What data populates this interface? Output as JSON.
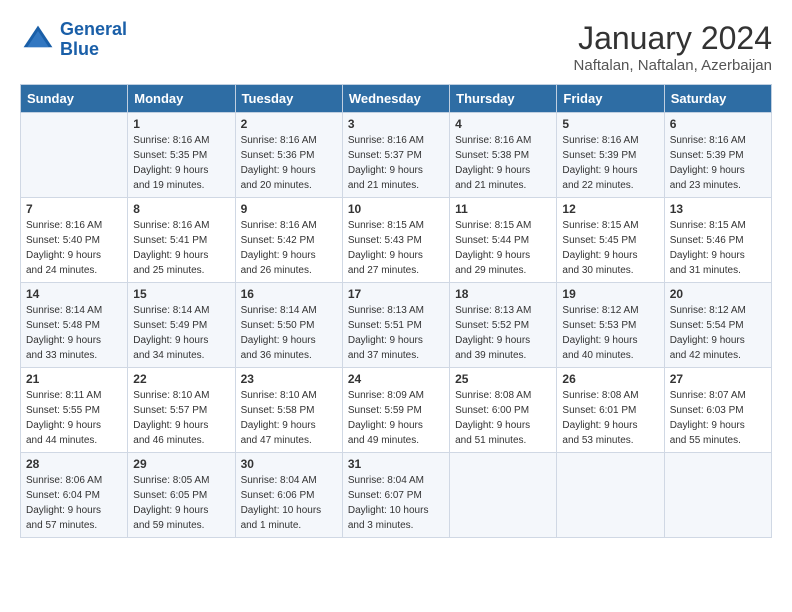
{
  "header": {
    "logo_line1": "General",
    "logo_line2": "Blue",
    "month_title": "January 2024",
    "location": "Naftalan, Naftalan, Azerbaijan"
  },
  "days_of_week": [
    "Sunday",
    "Monday",
    "Tuesday",
    "Wednesday",
    "Thursday",
    "Friday",
    "Saturday"
  ],
  "weeks": [
    [
      {
        "day": "",
        "info": ""
      },
      {
        "day": "1",
        "info": "Sunrise: 8:16 AM\nSunset: 5:35 PM\nDaylight: 9 hours\nand 19 minutes."
      },
      {
        "day": "2",
        "info": "Sunrise: 8:16 AM\nSunset: 5:36 PM\nDaylight: 9 hours\nand 20 minutes."
      },
      {
        "day": "3",
        "info": "Sunrise: 8:16 AM\nSunset: 5:37 PM\nDaylight: 9 hours\nand 21 minutes."
      },
      {
        "day": "4",
        "info": "Sunrise: 8:16 AM\nSunset: 5:38 PM\nDaylight: 9 hours\nand 21 minutes."
      },
      {
        "day": "5",
        "info": "Sunrise: 8:16 AM\nSunset: 5:39 PM\nDaylight: 9 hours\nand 22 minutes."
      },
      {
        "day": "6",
        "info": "Sunrise: 8:16 AM\nSunset: 5:39 PM\nDaylight: 9 hours\nand 23 minutes."
      }
    ],
    [
      {
        "day": "7",
        "info": "Sunrise: 8:16 AM\nSunset: 5:40 PM\nDaylight: 9 hours\nand 24 minutes."
      },
      {
        "day": "8",
        "info": "Sunrise: 8:16 AM\nSunset: 5:41 PM\nDaylight: 9 hours\nand 25 minutes."
      },
      {
        "day": "9",
        "info": "Sunrise: 8:16 AM\nSunset: 5:42 PM\nDaylight: 9 hours\nand 26 minutes."
      },
      {
        "day": "10",
        "info": "Sunrise: 8:15 AM\nSunset: 5:43 PM\nDaylight: 9 hours\nand 27 minutes."
      },
      {
        "day": "11",
        "info": "Sunrise: 8:15 AM\nSunset: 5:44 PM\nDaylight: 9 hours\nand 29 minutes."
      },
      {
        "day": "12",
        "info": "Sunrise: 8:15 AM\nSunset: 5:45 PM\nDaylight: 9 hours\nand 30 minutes."
      },
      {
        "day": "13",
        "info": "Sunrise: 8:15 AM\nSunset: 5:46 PM\nDaylight: 9 hours\nand 31 minutes."
      }
    ],
    [
      {
        "day": "14",
        "info": "Sunrise: 8:14 AM\nSunset: 5:48 PM\nDaylight: 9 hours\nand 33 minutes."
      },
      {
        "day": "15",
        "info": "Sunrise: 8:14 AM\nSunset: 5:49 PM\nDaylight: 9 hours\nand 34 minutes."
      },
      {
        "day": "16",
        "info": "Sunrise: 8:14 AM\nSunset: 5:50 PM\nDaylight: 9 hours\nand 36 minutes."
      },
      {
        "day": "17",
        "info": "Sunrise: 8:13 AM\nSunset: 5:51 PM\nDaylight: 9 hours\nand 37 minutes."
      },
      {
        "day": "18",
        "info": "Sunrise: 8:13 AM\nSunset: 5:52 PM\nDaylight: 9 hours\nand 39 minutes."
      },
      {
        "day": "19",
        "info": "Sunrise: 8:12 AM\nSunset: 5:53 PM\nDaylight: 9 hours\nand 40 minutes."
      },
      {
        "day": "20",
        "info": "Sunrise: 8:12 AM\nSunset: 5:54 PM\nDaylight: 9 hours\nand 42 minutes."
      }
    ],
    [
      {
        "day": "21",
        "info": "Sunrise: 8:11 AM\nSunset: 5:55 PM\nDaylight: 9 hours\nand 44 minutes."
      },
      {
        "day": "22",
        "info": "Sunrise: 8:10 AM\nSunset: 5:57 PM\nDaylight: 9 hours\nand 46 minutes."
      },
      {
        "day": "23",
        "info": "Sunrise: 8:10 AM\nSunset: 5:58 PM\nDaylight: 9 hours\nand 47 minutes."
      },
      {
        "day": "24",
        "info": "Sunrise: 8:09 AM\nSunset: 5:59 PM\nDaylight: 9 hours\nand 49 minutes."
      },
      {
        "day": "25",
        "info": "Sunrise: 8:08 AM\nSunset: 6:00 PM\nDaylight: 9 hours\nand 51 minutes."
      },
      {
        "day": "26",
        "info": "Sunrise: 8:08 AM\nSunset: 6:01 PM\nDaylight: 9 hours\nand 53 minutes."
      },
      {
        "day": "27",
        "info": "Sunrise: 8:07 AM\nSunset: 6:03 PM\nDaylight: 9 hours\nand 55 minutes."
      }
    ],
    [
      {
        "day": "28",
        "info": "Sunrise: 8:06 AM\nSunset: 6:04 PM\nDaylight: 9 hours\nand 57 minutes."
      },
      {
        "day": "29",
        "info": "Sunrise: 8:05 AM\nSunset: 6:05 PM\nDaylight: 9 hours\nand 59 minutes."
      },
      {
        "day": "30",
        "info": "Sunrise: 8:04 AM\nSunset: 6:06 PM\nDaylight: 10 hours\nand 1 minute."
      },
      {
        "day": "31",
        "info": "Sunrise: 8:04 AM\nSunset: 6:07 PM\nDaylight: 10 hours\nand 3 minutes."
      },
      {
        "day": "",
        "info": ""
      },
      {
        "day": "",
        "info": ""
      },
      {
        "day": "",
        "info": ""
      }
    ]
  ]
}
